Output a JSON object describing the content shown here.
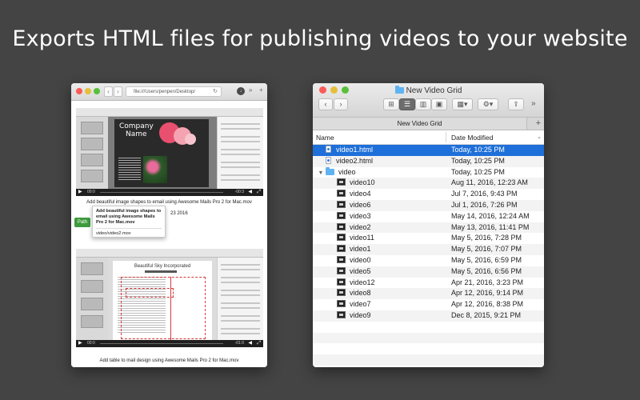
{
  "headline": "Exports HTML files for publishing videos to your website",
  "browser": {
    "url": "file:///Users/penpen/Desktop/",
    "video1": {
      "card_title_line1": "Company",
      "card_title_line2": "Name",
      "time_current": "00:0",
      "time_total": "-00:3",
      "caption": "Add beautiful image shapes to email using Awesome Mails Pro 2 for Mac.mov"
    },
    "tooltip": {
      "line1": "Add beautiful image shapes to email using Awesome Mails Pro 2 for Mac.mov",
      "line2": "video/video2.mov"
    },
    "date_fragment": "23 2016",
    "path_button": "Path",
    "video2": {
      "doc_title": "Beautiful Sky Incorporated",
      "time_current": "00:0",
      "time_total": "-01:0",
      "caption": "Add table to mail design using Awesome Mails Pro 2 for Mac.mov"
    }
  },
  "finder": {
    "title": "New Video Grid",
    "tab": "New Video Grid",
    "columns": {
      "name": "Name",
      "date": "Date Modified"
    },
    "rows": [
      {
        "name": "video1.html",
        "date": "Today, 10:25 PM",
        "icon": "html-file-icon",
        "indent": 1,
        "selected": true
      },
      {
        "name": "video2.html",
        "date": "Today, 10:25 PM",
        "icon": "html-file-icon",
        "indent": 1
      },
      {
        "name": "video",
        "date": "Today, 10:25 PM",
        "icon": "folder-icon",
        "indent": 0,
        "expanded": true
      },
      {
        "name": "video10",
        "date": "Aug 11, 2016, 12:23 AM",
        "icon": "video-file-icon",
        "indent": 2
      },
      {
        "name": "video4",
        "date": "Jul 7, 2016, 9:43 PM",
        "icon": "video-file-icon",
        "indent": 2
      },
      {
        "name": "video6",
        "date": "Jul 1, 2016, 7:26 PM",
        "icon": "video-file-icon",
        "indent": 2
      },
      {
        "name": "video3",
        "date": "May 14, 2016, 12:24 AM",
        "icon": "video-file-icon",
        "indent": 2
      },
      {
        "name": "video2",
        "date": "May 13, 2016, 11:41 PM",
        "icon": "video-file-icon",
        "indent": 2
      },
      {
        "name": "video11",
        "date": "May 5, 2016, 7:28 PM",
        "icon": "video-file-icon",
        "indent": 2
      },
      {
        "name": "video1",
        "date": "May 5, 2016, 7:07 PM",
        "icon": "video-file-icon",
        "indent": 2
      },
      {
        "name": "video0",
        "date": "May 5, 2016, 6:59 PM",
        "icon": "video-file-icon",
        "indent": 2
      },
      {
        "name": "video5",
        "date": "May 5, 2016, 6:56 PM",
        "icon": "video-file-icon",
        "indent": 2
      },
      {
        "name": "video12",
        "date": "Apr 21, 2016, 3:23 PM",
        "icon": "video-file-icon",
        "indent": 2
      },
      {
        "name": "video8",
        "date": "Apr 12, 2016, 9:14 PM",
        "icon": "video-file-icon",
        "indent": 2
      },
      {
        "name": "video7",
        "date": "Apr 12, 2016, 8:38 PM",
        "icon": "video-file-icon",
        "indent": 2
      },
      {
        "name": "video9",
        "date": "Dec 8, 2015, 9:21 PM",
        "icon": "video-file-icon",
        "indent": 2
      }
    ]
  },
  "colors": {
    "background": "#444444",
    "selection": "#1e6fd9",
    "path_button": "#3e9b3e",
    "close": "#fc5b57",
    "minimize": "#e5bf3c",
    "zoom": "#57c038"
  }
}
